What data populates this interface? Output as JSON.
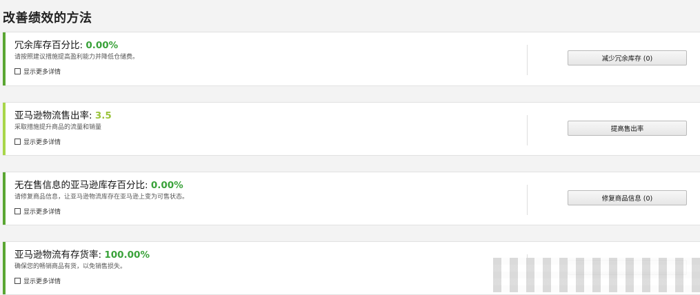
{
  "page": {
    "title": "改善绩效的方法"
  },
  "cards": [
    {
      "metric_label": "冗余库存百分比:",
      "metric_value": "0.00%",
      "value_color": "#3aa23a",
      "accent_color": "#5aa632",
      "description": "请按照建议措施提高盈利能力并降低仓储费。",
      "details_label": "显示更多详情",
      "action_label": "减少冗余库存 (0)"
    },
    {
      "metric_label": "亚马逊物流售出率:",
      "metric_value": "3.5",
      "value_color": "#9ac33a",
      "accent_color": "#a8d64a",
      "description": "采取措施提升商品的流量和销量",
      "details_label": "显示更多详情",
      "action_label": "提高售出率"
    },
    {
      "metric_label": "无在售信息的亚马逊库存百分比:",
      "metric_value": "0.00%",
      "value_color": "#3aa23a",
      "accent_color": "#5aa632",
      "description": "请修复商品信息，让亚马逊物流库存在亚马逊上变为可售状态。",
      "details_label": "显示更多详情",
      "action_label": "修复商品信息 (0)"
    },
    {
      "metric_label": "亚马逊物流有存货率:",
      "metric_value": "100.00%",
      "value_color": "#3aa23a",
      "accent_color": "#5aa632",
      "description": "确保您的畅销商品有货，以免销售损失。",
      "details_label": "显示更多详情",
      "action_label": ""
    }
  ]
}
